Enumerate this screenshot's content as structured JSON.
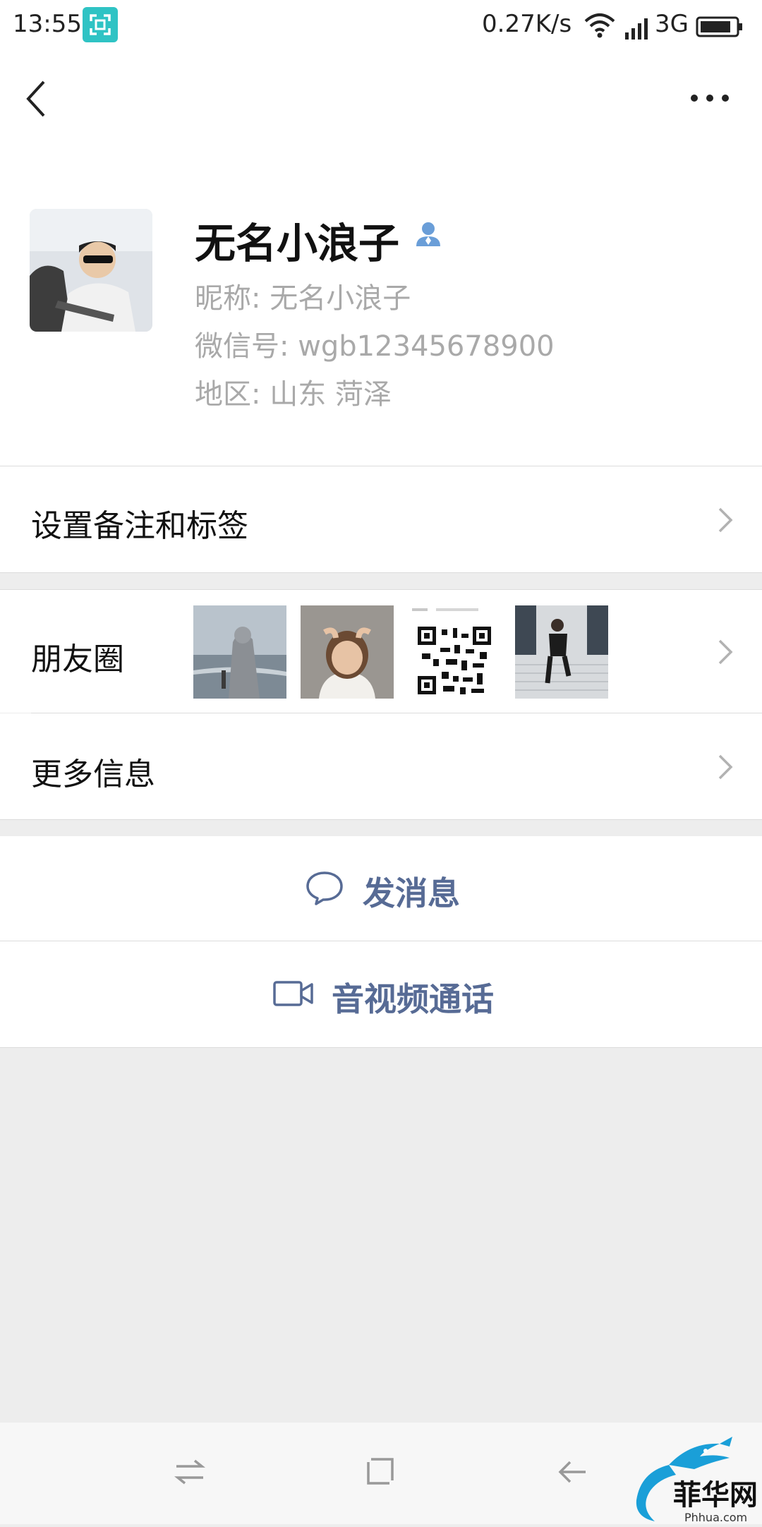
{
  "status_bar": {
    "time": "13:55",
    "net_speed": "0.27K/s",
    "network_type": "3G",
    "icons": [
      "screenshot-scan-icon",
      "wifi-icon",
      "signal-icon",
      "battery-icon"
    ]
  },
  "nav": {
    "icons": [
      "back-icon",
      "more-icon"
    ]
  },
  "profile": {
    "name": "无名小浪子",
    "nickname_line": "昵称: 无名小浪子",
    "wechat_id_line": "微信号: wgb12345678900",
    "region_line": "地区: 山东  菏泽"
  },
  "menu": {
    "remark_label": "设置备注和标签",
    "moments_label": "朋友圈",
    "more_info_label": "更多信息"
  },
  "actions": {
    "message_label": "发消息",
    "call_label": "音视频通话"
  },
  "watermark": {
    "brand": "菲华网",
    "url": "Phhua.com"
  },
  "colors": {
    "link_blue": "#576b95",
    "accent_teal": "#2fc3c4"
  }
}
